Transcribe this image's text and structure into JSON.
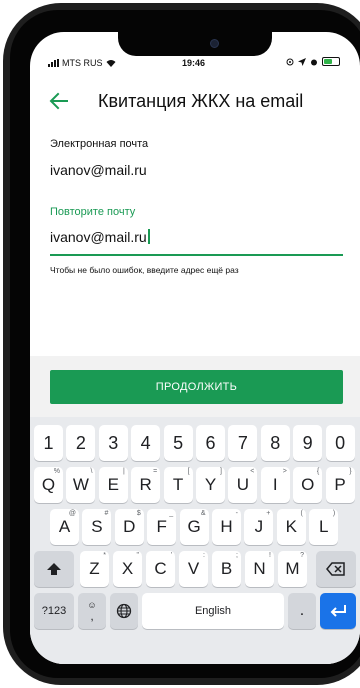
{
  "status_bar": {
    "carrier": "MTS RUS",
    "time": "19:46",
    "icons": [
      "signal-icon",
      "wifi-icon",
      "location-icon",
      "alarm-icon",
      "battery-icon"
    ]
  },
  "header": {
    "title": "Квитанция ЖКХ на email",
    "back_icon": "arrow-left-icon"
  },
  "form": {
    "email_label": "Электронная почта",
    "email_value": "ivanov@mail.ru",
    "repeat_label": "Повторите почту",
    "repeat_value": "ivanov@mail.ru",
    "hint": "Чтобы не было ошибок, введите адрес ещё раз",
    "continue_label": "ПРОДОЛЖИТЬ"
  },
  "keyboard": {
    "row_numbers": [
      "1",
      "2",
      "3",
      "4",
      "5",
      "6",
      "7",
      "8",
      "9",
      "0"
    ],
    "row_1": [
      {
        "key": "Q",
        "alt": "%"
      },
      {
        "key": "W",
        "alt": "\\"
      },
      {
        "key": "E",
        "alt": "|"
      },
      {
        "key": "R",
        "alt": "="
      },
      {
        "key": "T",
        "alt": "["
      },
      {
        "key": "Y",
        "alt": "]"
      },
      {
        "key": "U",
        "alt": "<"
      },
      {
        "key": "I",
        "alt": ">"
      },
      {
        "key": "O",
        "alt": "{"
      },
      {
        "key": "P",
        "alt": "}"
      }
    ],
    "row_2": [
      {
        "key": "A",
        "alt": "@"
      },
      {
        "key": "S",
        "alt": "#"
      },
      {
        "key": "D",
        "alt": "$"
      },
      {
        "key": "F",
        "alt": "_"
      },
      {
        "key": "G",
        "alt": "&"
      },
      {
        "key": "H",
        "alt": "-"
      },
      {
        "key": "J",
        "alt": "+"
      },
      {
        "key": "K",
        "alt": "("
      },
      {
        "key": "L",
        "alt": ")"
      }
    ],
    "row_3": [
      {
        "key": "Z",
        "alt": "*"
      },
      {
        "key": "X",
        "alt": "\""
      },
      {
        "key": "C",
        "alt": "'"
      },
      {
        "key": "V",
        "alt": ":"
      },
      {
        "key": "B",
        "alt": ";"
      },
      {
        "key": "N",
        "alt": "!"
      },
      {
        "key": "M",
        "alt": "?"
      }
    ],
    "symbols_label": "?123",
    "comma_label": ",",
    "space_label": "English",
    "period_label": "."
  },
  "colors": {
    "accent": "#1a9a54",
    "enter_key": "#1a73e8"
  }
}
